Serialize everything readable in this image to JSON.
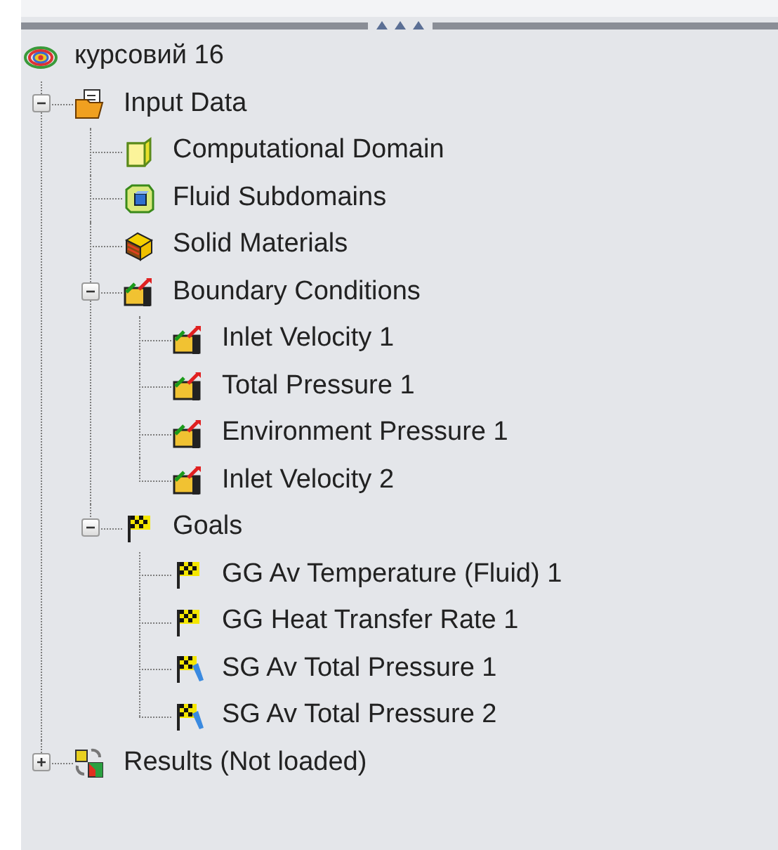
{
  "tree": {
    "label": "курсовий 16",
    "kind": "project",
    "children": [
      {
        "label": "Input Data",
        "kind": "input",
        "expanded": true,
        "children": [
          {
            "label": "Computational Domain",
            "kind": "domain"
          },
          {
            "label": "Fluid Subdomains",
            "kind": "fluid"
          },
          {
            "label": "Solid Materials",
            "kind": "solid"
          },
          {
            "label": "Boundary Conditions",
            "kind": "boundary",
            "expanded": true,
            "children": [
              {
                "label": "Inlet Velocity 1",
                "kind": "boundary"
              },
              {
                "label": "Total Pressure 1",
                "kind": "boundary"
              },
              {
                "label": "Environment Pressure 1",
                "kind": "boundary"
              },
              {
                "label": "Inlet Velocity 2",
                "kind": "boundary"
              }
            ]
          },
          {
            "label": "Goals",
            "kind": "goal",
            "expanded": true,
            "children": [
              {
                "label": "GG Av Temperature (Fluid) 1",
                "kind": "goal"
              },
              {
                "label": "GG Heat Transfer Rate 1",
                "kind": "goal"
              },
              {
                "label": "SG Av Total Pressure 1",
                "kind": "surface-goal"
              },
              {
                "label": "SG Av Total Pressure 2",
                "kind": "surface-goal"
              }
            ]
          }
        ]
      },
      {
        "label": "Results (Not loaded)",
        "kind": "results",
        "expanded": false
      }
    ]
  }
}
